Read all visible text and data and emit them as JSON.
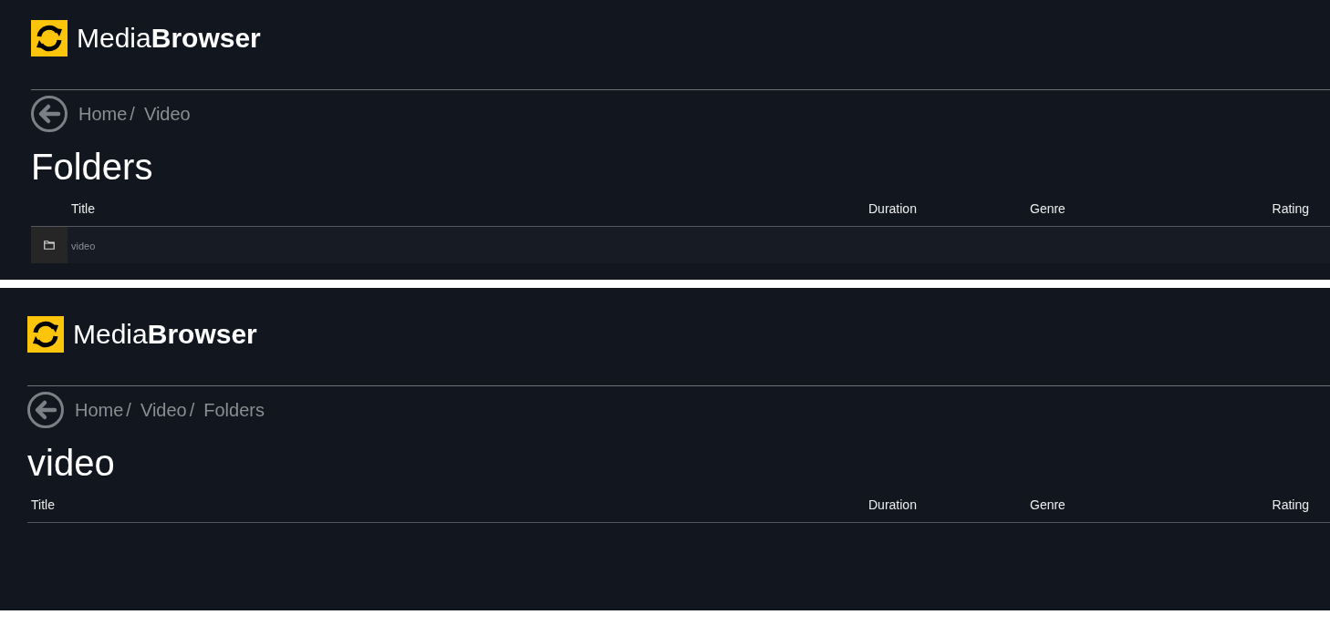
{
  "panels": [
    {
      "logo": {
        "text": "Media**Browser**"
      },
      "breadcrumb": [
        {
          "label": "Home",
          "separator": "/"
        },
        {
          "label": "Video"
        }
      ],
      "title": "Folders",
      "table": {
        "columns": [
          "Title",
          "Duration",
          "Genre",
          "Rating"
        ],
        "rows": [
          {
            "kind": "folder",
            "title": "video"
          }
        ]
      }
    },
    {
      "logo": {
        "text": "Media**Browser**"
      },
      "breadcrumb": [
        {
          "label": "Home",
          "separator": "/"
        },
        {
          "label": "Video",
          "separator": "/"
        },
        {
          "label": "Folders"
        }
      ],
      "title": "video",
      "table": {
        "columns": [
          "Title",
          "Duration",
          "Genre",
          "Rating"
        ]
      }
    }
  ]
}
